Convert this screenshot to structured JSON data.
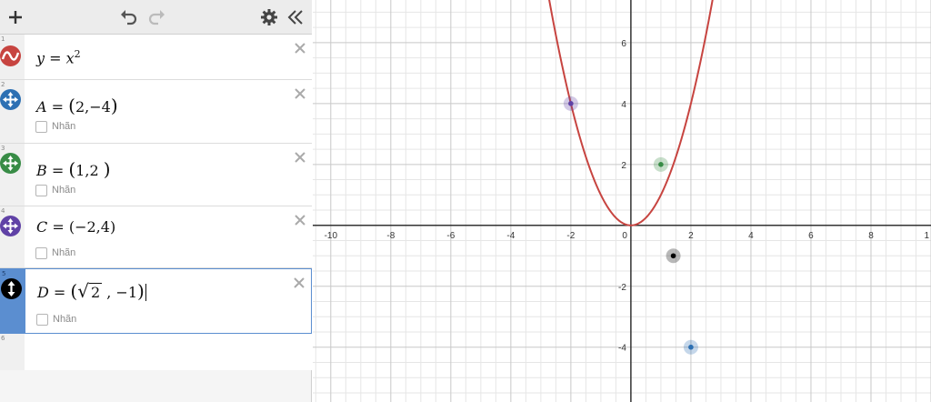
{
  "toolbar": {
    "add_icon": "plus-icon",
    "undo_icon": "undo-icon",
    "redo_icon": "redo-icon",
    "settings_icon": "gear-icon",
    "collapse_icon": "double-chevron-left-icon"
  },
  "expressions": [
    {
      "index": "1",
      "type": "function",
      "lhs": "y",
      "rhs_base": "x",
      "rhs_exp": "2",
      "color": "#c74440"
    },
    {
      "index": "2",
      "type": "point",
      "name": "A",
      "x": "2",
      "y": "−4",
      "color": "#2d70b3",
      "label": "Nhãn"
    },
    {
      "index": "3",
      "type": "point",
      "name": "B",
      "x": "1",
      "y": "2",
      "color": "#388c46",
      "label": "Nhãn"
    },
    {
      "index": "4",
      "type": "point",
      "name": "C",
      "x": "−2",
      "y": "4",
      "color": "#6042a6",
      "label": "Nhãn"
    },
    {
      "index": "5",
      "type": "point",
      "name": "D",
      "x_radicand": "2",
      "y": "−1",
      "color": "#000000",
      "label": "Nhãn"
    }
  ],
  "empty_row_index": "6",
  "colors": {
    "parabola": "#c74440",
    "point_A": "#2d70b3",
    "point_B": "#388c46",
    "point_C": "#6042a6",
    "point_D": "#000000",
    "active_row": "#5b8ed0"
  },
  "graph": {
    "x_ticks": [
      "-10",
      "-8",
      "-6",
      "-4",
      "-2",
      "0",
      "2",
      "4",
      "6",
      "8",
      "1"
    ],
    "y_ticks": [
      "6",
      "4",
      "2",
      "-2",
      "-4"
    ],
    "x_range": [
      -10.6,
      10.0
    ],
    "y_range": [
      -5.8,
      7.4
    ],
    "grid": true,
    "curve": "y = x^2",
    "points": [
      {
        "name": "A",
        "x": 2,
        "y": -4
      },
      {
        "name": "B",
        "x": 1,
        "y": 2
      },
      {
        "name": "C",
        "x": -2,
        "y": 4
      },
      {
        "name": "D",
        "x": 1.414,
        "y": -1
      }
    ]
  }
}
